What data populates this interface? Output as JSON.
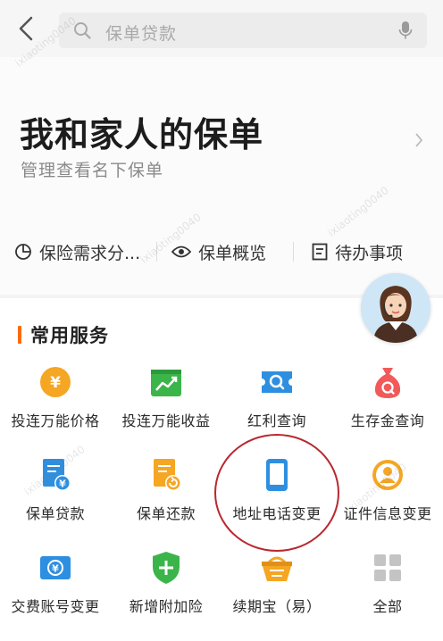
{
  "search": {
    "placeholder": "保单贷款"
  },
  "header": {
    "title": "我和家人的保单",
    "subtitle": "管理查看名下保单"
  },
  "quick_links": [
    {
      "label": "保险需求分...",
      "icon": "pie-chart-icon"
    },
    {
      "label": "保单概览",
      "icon": "eye-icon"
    },
    {
      "label": "待办事项",
      "icon": "list-icon"
    }
  ],
  "services": {
    "title": "常用服务",
    "items": [
      {
        "label": "投连万能价格",
        "icon": "yuan-coin-icon",
        "color": "#f5a623"
      },
      {
        "label": "投连万能收益",
        "icon": "trend-chart-icon",
        "color": "#3bb54a"
      },
      {
        "label": "红利查询",
        "icon": "ticket-search-icon",
        "color": "#2e8fe0"
      },
      {
        "label": "生存金查询",
        "icon": "money-bag-icon",
        "color": "#f25a5a"
      },
      {
        "label": "保单贷款",
        "icon": "policy-yuan-icon",
        "color": "#2e8fe0"
      },
      {
        "label": "保单还款",
        "icon": "policy-return-icon",
        "color": "#f5a623"
      },
      {
        "label": "地址电话变更",
        "icon": "phone-icon",
        "color": "#2e8fe0"
      },
      {
        "label": "证件信息变更",
        "icon": "user-id-icon",
        "color": "#f5a623"
      },
      {
        "label": "交费账号变更",
        "icon": "account-exchange-icon",
        "color": "#2e8fe0"
      },
      {
        "label": "新增附加险",
        "icon": "shield-plus-icon",
        "color": "#3bb54a"
      },
      {
        "label": "续期宝（易）",
        "icon": "basket-icon",
        "color": "#f5a623"
      },
      {
        "label": "全部",
        "icon": "grid-icon",
        "color": "#c4c4c4"
      }
    ]
  },
  "colors": {
    "accent": "#ff6a00",
    "annotation": "#b8282e"
  }
}
